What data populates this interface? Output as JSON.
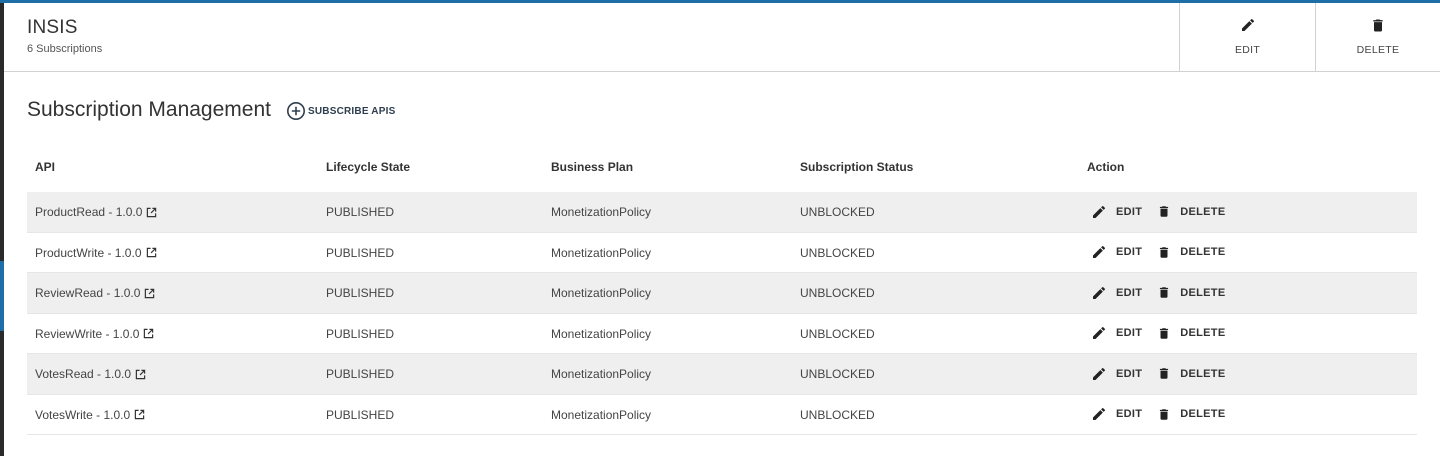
{
  "header": {
    "title": "INSIS",
    "subtitle": "6 Subscriptions",
    "edit_label": "EDIT",
    "delete_label": "DELETE"
  },
  "section": {
    "title": "Subscription Management",
    "subscribe_label": "SUBSCRIBE APIS"
  },
  "table": {
    "columns": [
      "API",
      "Lifecycle State",
      "Business Plan",
      "Subscription Status",
      "Action"
    ],
    "rows": [
      {
        "api": "ProductRead - 1.0.0",
        "lifecycle": "PUBLISHED",
        "plan": "MonetizationPolicy",
        "status": "UNBLOCKED",
        "edit": "EDIT",
        "delete": "DELETE"
      },
      {
        "api": "ProductWrite - 1.0.0",
        "lifecycle": "PUBLISHED",
        "plan": "MonetizationPolicy",
        "status": "UNBLOCKED",
        "edit": "EDIT",
        "delete": "DELETE"
      },
      {
        "api": "ReviewRead - 1.0.0",
        "lifecycle": "PUBLISHED",
        "plan": "MonetizationPolicy",
        "status": "UNBLOCKED",
        "edit": "EDIT",
        "delete": "DELETE"
      },
      {
        "api": "ReviewWrite - 1.0.0",
        "lifecycle": "PUBLISHED",
        "plan": "MonetizationPolicy",
        "status": "UNBLOCKED",
        "edit": "EDIT",
        "delete": "DELETE"
      },
      {
        "api": "VotesRead - 1.0.0",
        "lifecycle": "PUBLISHED",
        "plan": "MonetizationPolicy",
        "status": "UNBLOCKED",
        "edit": "EDIT",
        "delete": "DELETE"
      },
      {
        "api": "VotesWrite - 1.0.0",
        "lifecycle": "PUBLISHED",
        "plan": "MonetizationPolicy",
        "status": "UNBLOCKED",
        "edit": "EDIT",
        "delete": "DELETE"
      }
    ]
  },
  "icons": {
    "edit": "pencil-icon",
    "delete": "trash-icon",
    "subscribe": "plus-circle-icon",
    "external": "external-link-icon"
  },
  "colors": {
    "accent": "#1e6ea8",
    "row_alt": "#efefef",
    "text": "#333333"
  }
}
